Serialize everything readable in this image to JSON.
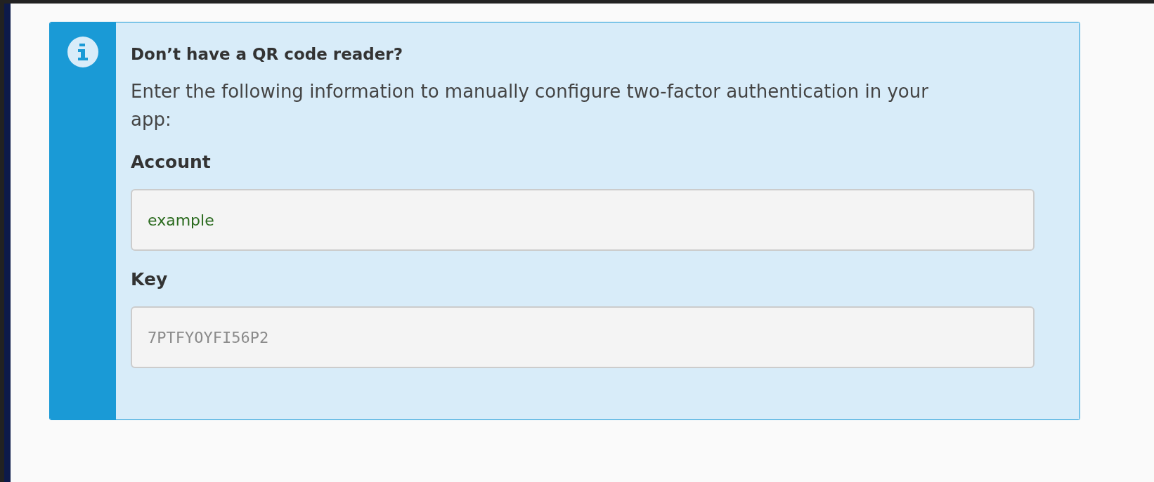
{
  "alert": {
    "title": "Don’t have a QR code reader?",
    "message": "Enter the following information to manually configure two-factor authentication in your app:",
    "fields": [
      {
        "label": "Account",
        "value": "example",
        "kind": "account"
      },
      {
        "label": "Key",
        "value": "7PTFYOYFI56P2",
        "kind": "key"
      }
    ]
  }
}
